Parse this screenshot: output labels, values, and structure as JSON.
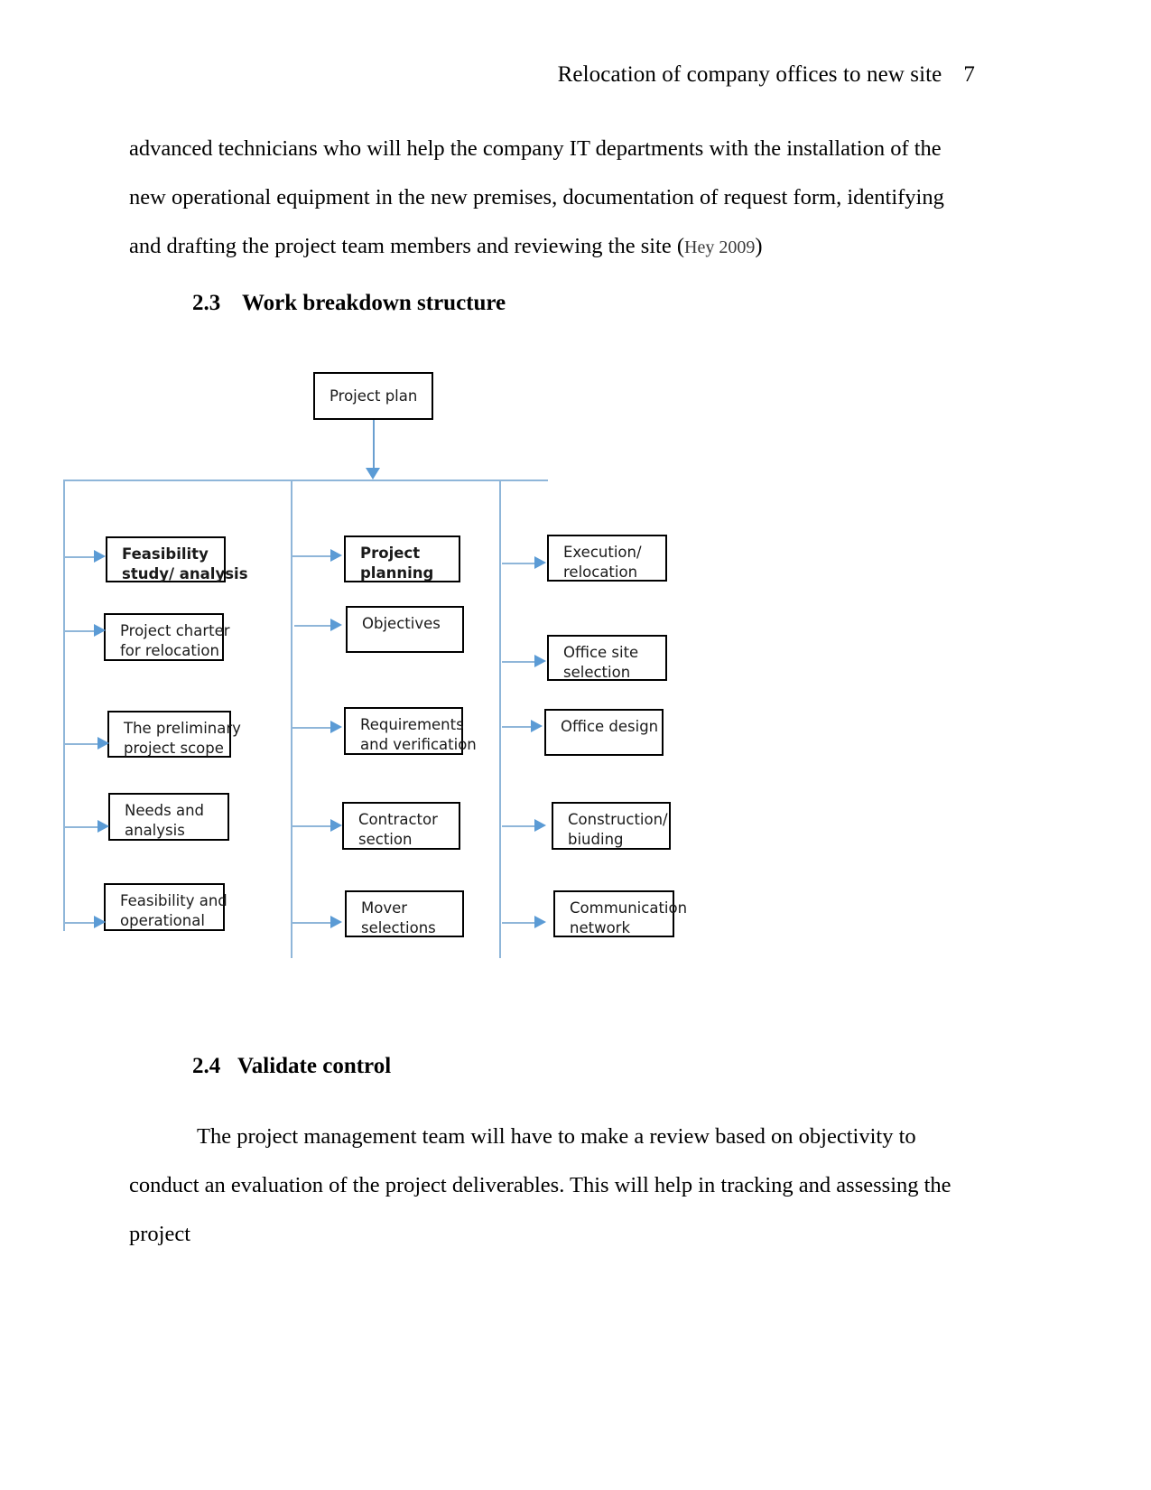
{
  "header": {
    "title": "Relocation of company offices to new site",
    "page_number": "7"
  },
  "paragraphs": {
    "para1_text": "advanced technicians who will help the company IT departments with the installation of the new operational equipment in the new premises, documentation of request form, identifying and drafting the project team members and reviewing the site (",
    "para1_citation": "Hey 2009",
    "para1_close": ")",
    "para2_text": "The project management team will have to make a review based on objectivity to conduct an evaluation of the project deliverables. This will help in tracking and assessing the project"
  },
  "headings": {
    "s23_number": "2.3",
    "s23_title": "Work breakdown structure",
    "s24_number": "2.4",
    "s24_title": "Validate control"
  },
  "diagram": {
    "root": {
      "label": "Project plan"
    },
    "columns": [
      {
        "name": "feasibility-column",
        "boxes": [
          {
            "line1": "Feasibility",
            "line2": "study/ analysis",
            "bold": true
          },
          {
            "line1": "Project charter",
            "line2": "for relocation",
            "bold": false
          },
          {
            "line1": "The preliminary",
            "line2": "project scope",
            "bold": false
          },
          {
            "line1": "Needs and",
            "line2": "analysis",
            "bold": false
          },
          {
            "line1": "Feasibility and",
            "line2": "operational",
            "bold": false
          }
        ]
      },
      {
        "name": "planning-column",
        "boxes": [
          {
            "line1": "Project",
            "line2": "planning",
            "bold": true
          },
          {
            "line1": "Objectives",
            "line2": "",
            "bold": false
          },
          {
            "line1": "Requirements",
            "line2": "and verification",
            "bold": false
          },
          {
            "line1": "Contractor",
            "line2": "section",
            "bold": false
          },
          {
            "line1": "Mover",
            "line2": "selections",
            "bold": false
          }
        ]
      },
      {
        "name": "execution-column",
        "boxes": [
          {
            "line1": "Execution/",
            "line2": "relocation",
            "bold": false
          },
          {
            "line1": "Office site",
            "line2": "selection",
            "bold": false
          },
          {
            "line1": "Office design",
            "line2": "",
            "bold": false
          },
          {
            "line1": "Construction/",
            "line2": "biuding",
            "bold": false
          },
          {
            "line1": "Communication",
            "line2": "network",
            "bold": false
          }
        ]
      }
    ],
    "colors": {
      "connector": "#8fb6d9",
      "arrow": "#5b9bd5",
      "box_border": "#000000"
    }
  }
}
